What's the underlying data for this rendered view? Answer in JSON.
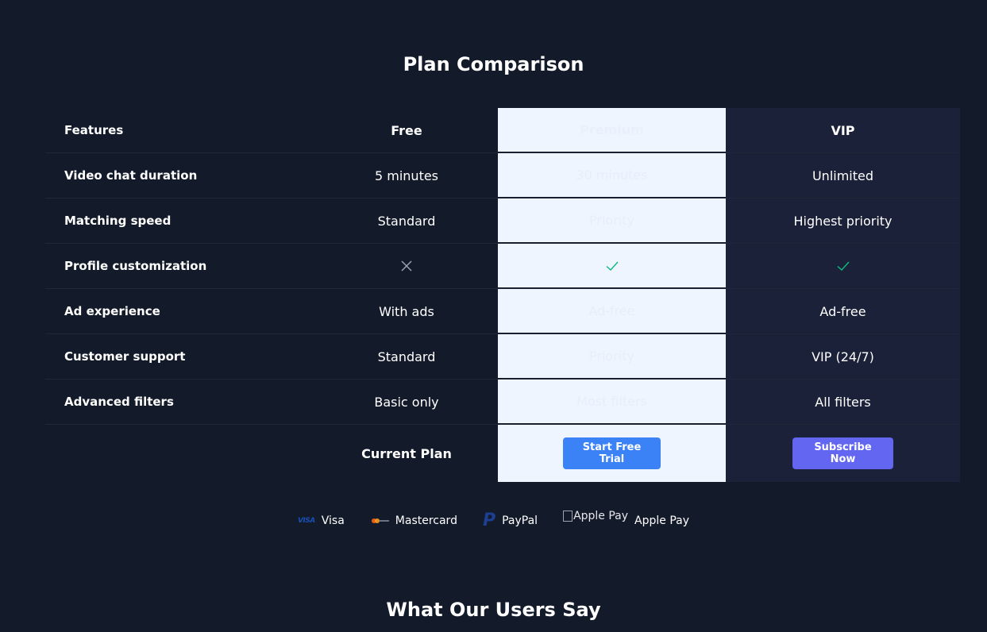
{
  "titles": {
    "plan_comparison": "Plan Comparison",
    "testimonials": "What Our Users Say"
  },
  "table": {
    "headers": {
      "feature": "Features",
      "free": "Free",
      "pro": "Premium",
      "vip": "VIP"
    },
    "rows": [
      {
        "feature": "Video chat duration",
        "free": "5 minutes",
        "pro": "30 minutes",
        "vip": "Unlimited"
      },
      {
        "feature": "Matching speed",
        "free": "Standard",
        "pro": "Priority",
        "vip": "Highest priority"
      },
      {
        "feature": "Profile customization",
        "free_icon": "x-icon",
        "pro_icon": "check-icon",
        "vip_icon": "check-icon"
      },
      {
        "feature": "Ad experience",
        "free": "With ads",
        "pro": "Ad-free",
        "vip": "Ad-free"
      },
      {
        "feature": "Customer support",
        "free": "Standard",
        "pro": "Priority",
        "vip": "VIP (24/7)"
      },
      {
        "feature": "Advanced filters",
        "free": "Basic only",
        "pro": "Most filters",
        "vip": "All filters"
      }
    ],
    "footer": {
      "free": "Current Plan",
      "pro_button": "Start Free Trial",
      "vip_button": "Subscribe Now"
    }
  },
  "payments": [
    {
      "icon": "visa-logo-icon",
      "logo_text": "VISA",
      "label": "Visa"
    },
    {
      "icon": "mastercard-logo-icon",
      "label": "Mastercard"
    },
    {
      "icon": "paypal-logo-icon",
      "logo_text": "P",
      "label": "PayPal"
    },
    {
      "icon": "apple-pay-broken-image-icon",
      "alt_text": "Apple Pay",
      "label": "Apple Pay"
    }
  ],
  "colors": {
    "background": "#131a2a",
    "pro_column": "#eef5ff",
    "vip_column": "#1a2138",
    "check": "#10b981",
    "trial_button": "#3b82f6",
    "subscribe_button": "#6366f1"
  }
}
